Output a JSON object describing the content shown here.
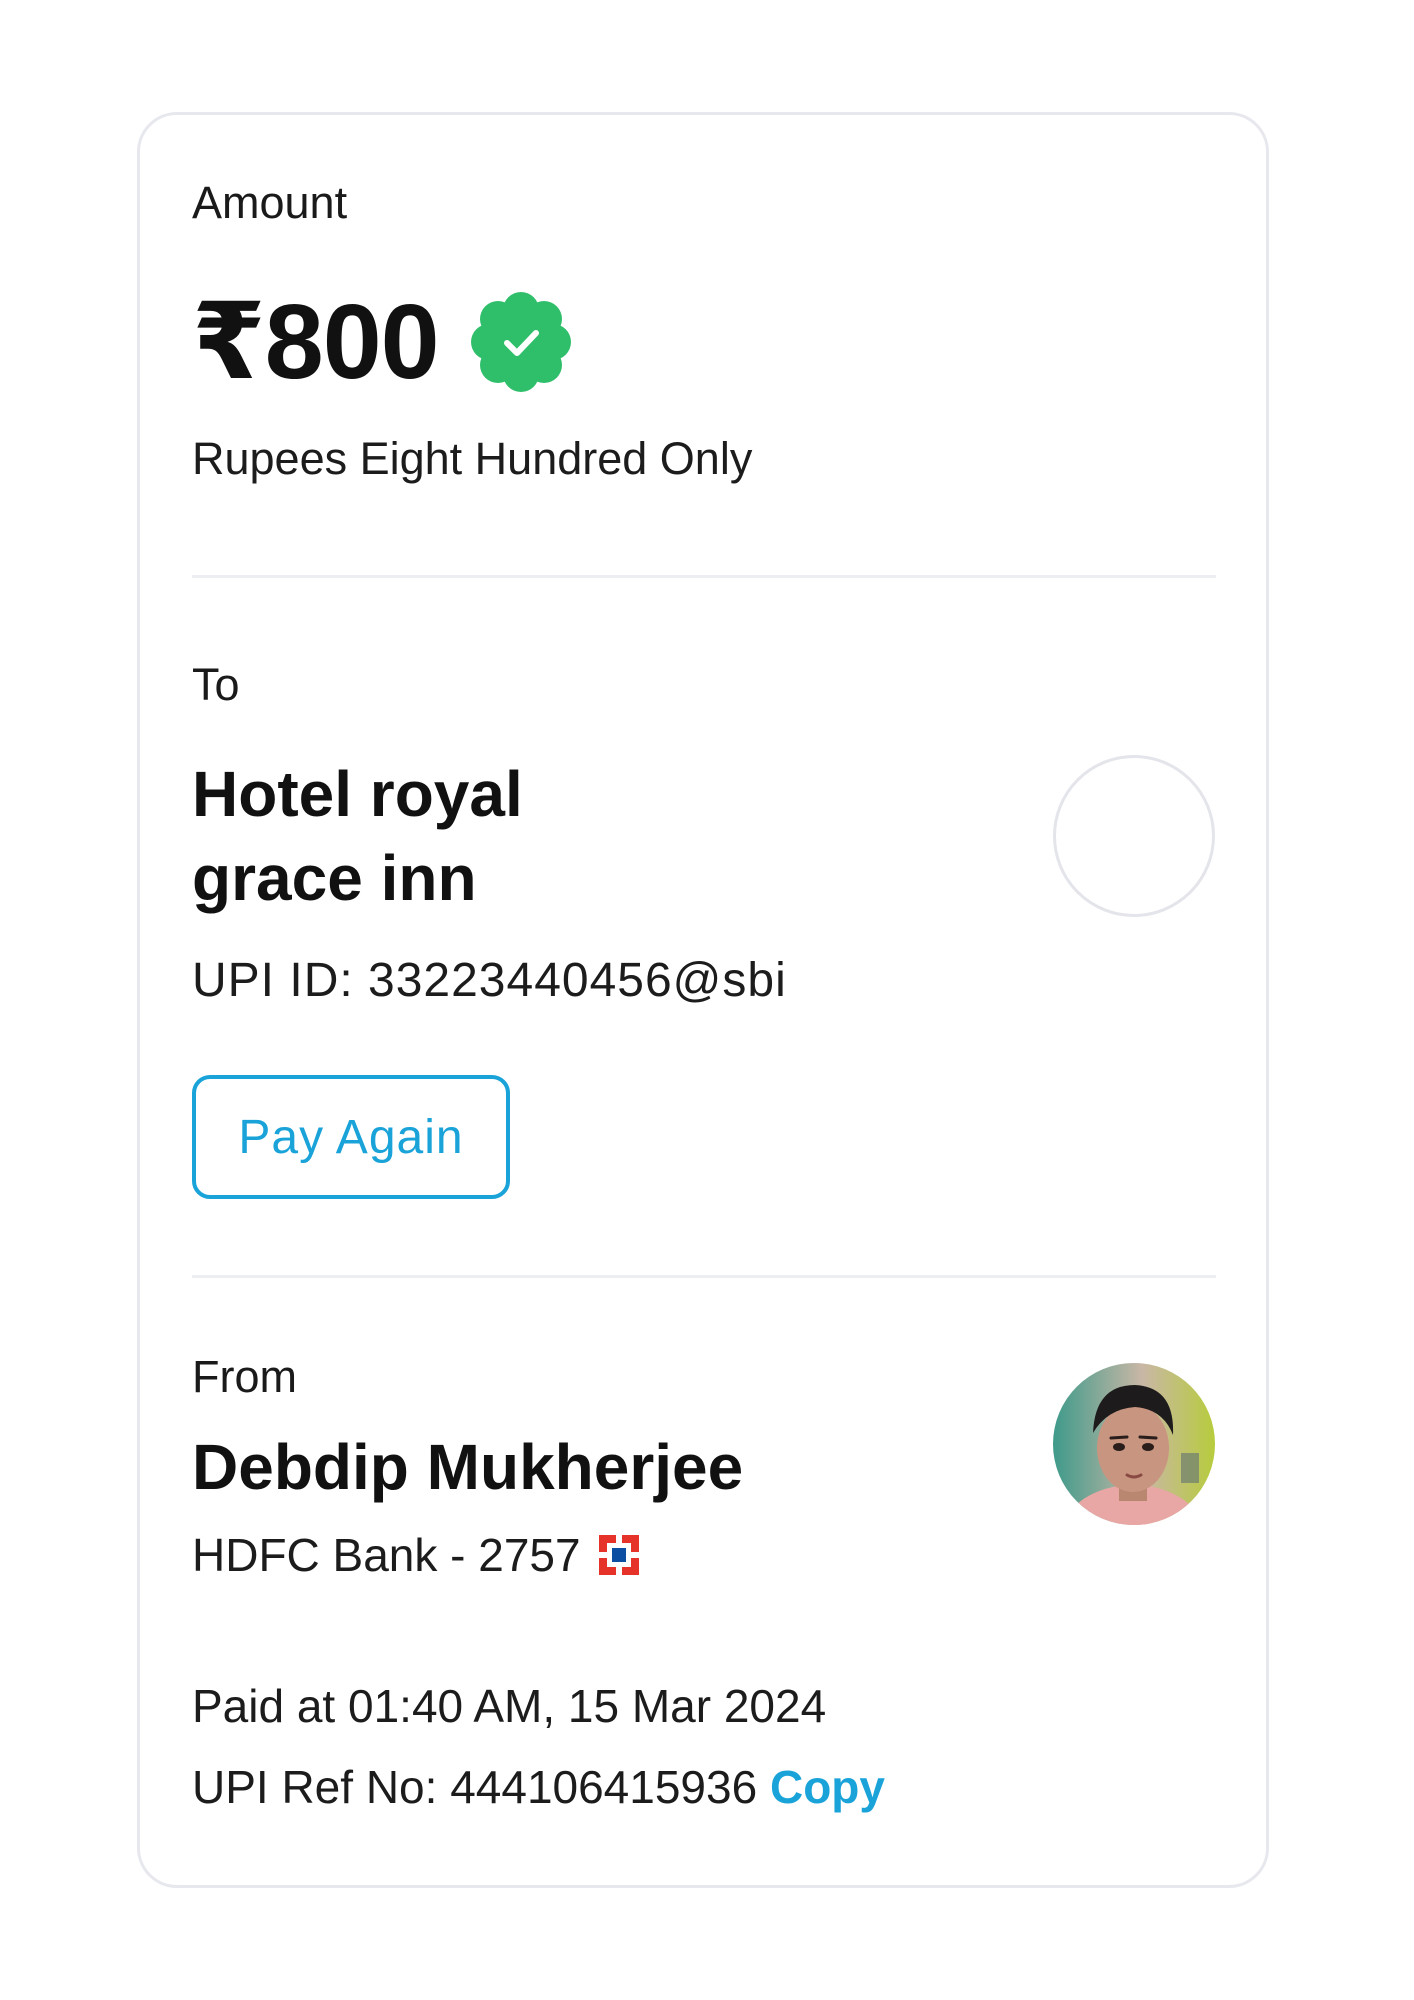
{
  "amount_section": {
    "label": "Amount",
    "amount": "₹800",
    "amount_words": "Rupees Eight Hundred Only",
    "status_icon": "verified-check-icon",
    "status_color": "#2fbf6b"
  },
  "to_section": {
    "label": "To",
    "name": "Hotel royal grace inn",
    "upi_id": "UPI ID: 33223440456@sbi",
    "pay_again_label": "Pay Again"
  },
  "from_section": {
    "label": "From",
    "name": "Debdip Mukherjee",
    "bank": "HDFC Bank - 2757",
    "bank_icon": "hdfc-bank-logo-icon"
  },
  "details": {
    "paid_at": "Paid at 01:40 AM, 15 Mar 2024",
    "ref_prefix": "UPI Ref No: 444106415936 ",
    "copy_label": "Copy"
  },
  "colors": {
    "accent": "#1aa3d9",
    "success": "#2fbf6b",
    "bank_red": "#e5332a",
    "bank_blue": "#0b4ea2"
  }
}
